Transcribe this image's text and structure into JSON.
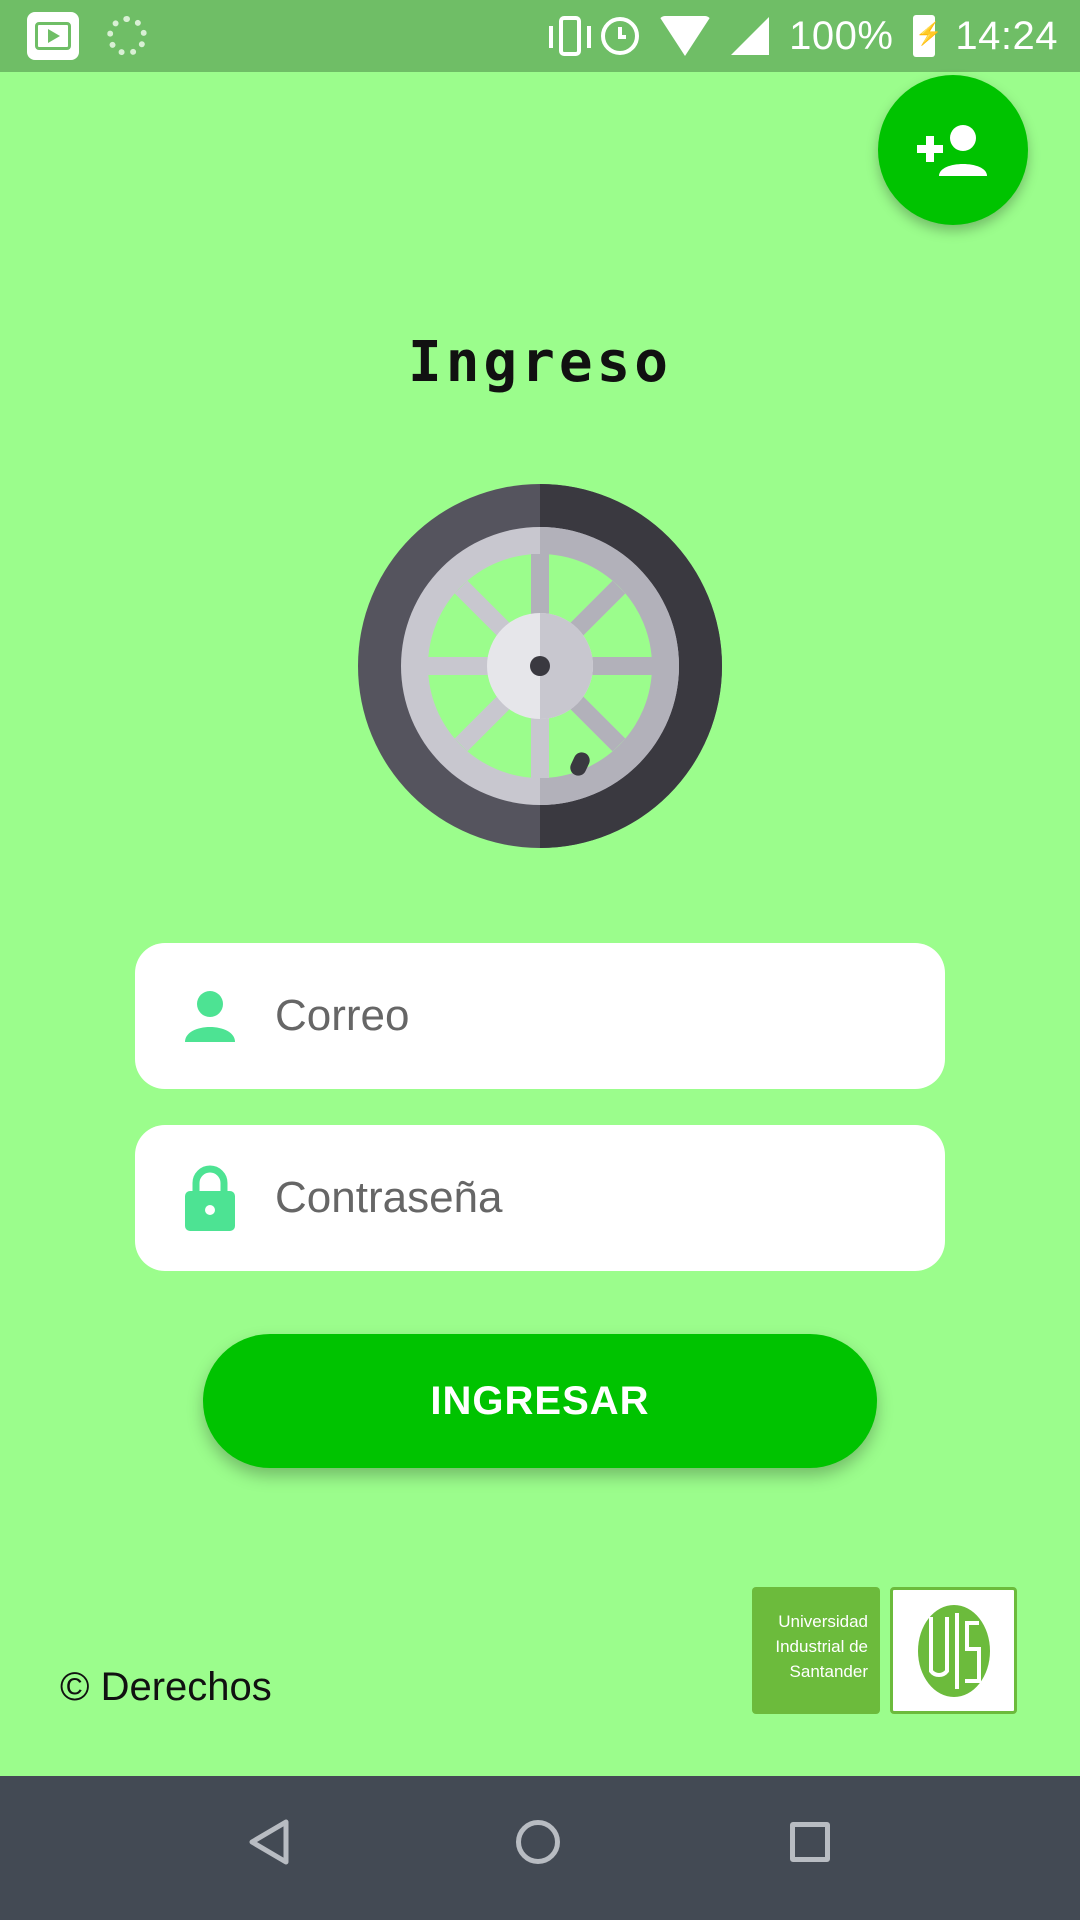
{
  "status_bar": {
    "battery": "100%",
    "time": "14:24",
    "icons": [
      "youtube-icon",
      "loading-spinner-icon",
      "vibrate-icon",
      "alarm-icon",
      "wifi-icon",
      "signal-icon",
      "battery-charging-icon"
    ]
  },
  "header": {
    "title": "Ingreso"
  },
  "fab": {
    "icon": "add-user-icon"
  },
  "form": {
    "email": {
      "placeholder": "Correo",
      "icon": "person-icon"
    },
    "password": {
      "placeholder": "Contraseña",
      "icon": "lock-icon"
    },
    "submit_label": "INGRESAR"
  },
  "footer": {
    "copyright": "© Derechos",
    "university_logo_text": [
      "Universidad",
      "Industrial de",
      "Santander"
    ]
  },
  "colors": {
    "background": "#9bfd8c",
    "status_bar": "#6fbe66",
    "primary": "#00c300",
    "input_icon": "#4de393",
    "logo_green": "#6cbb3c",
    "nav_bar": "#434a54"
  }
}
